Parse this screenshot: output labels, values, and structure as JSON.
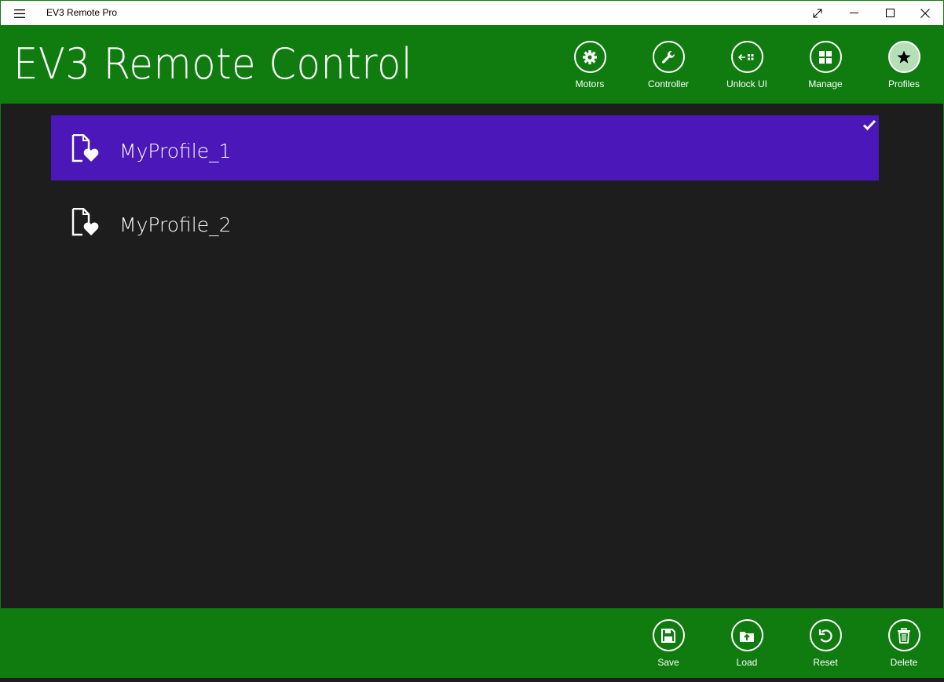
{
  "window": {
    "title": "EV3 Remote Pro",
    "controls": [
      "fullscreen-icon",
      "minimize-icon",
      "maximize-icon",
      "close-icon"
    ]
  },
  "header": {
    "title": "EV3 Remote Control",
    "nav": [
      {
        "label": "Motors",
        "icon": "gear-icon"
      },
      {
        "label": "Controller",
        "icon": "wrench-icon"
      },
      {
        "label": "Unlock UI",
        "icon": "unlock-ui-icon"
      },
      {
        "label": "Manage",
        "icon": "grid-icon"
      },
      {
        "label": "Profiles",
        "icon": "star-icon",
        "selected": true
      }
    ]
  },
  "profiles": [
    {
      "name": "MyProfile_1",
      "selected": true
    },
    {
      "name": "MyProfile_2",
      "selected": false
    }
  ],
  "bottom_bar": {
    "actions": [
      {
        "label": "Save",
        "icon": "save-icon"
      },
      {
        "label": "Load",
        "icon": "load-icon"
      },
      {
        "label": "Reset",
        "icon": "undo-icon"
      },
      {
        "label": "Delete",
        "icon": "trash-icon"
      }
    ]
  },
  "colors": {
    "accent": "#107c10",
    "selection": "#4b17b9",
    "background": "#1d1d1d",
    "selected_nav_fill": "#b7dfb7"
  }
}
